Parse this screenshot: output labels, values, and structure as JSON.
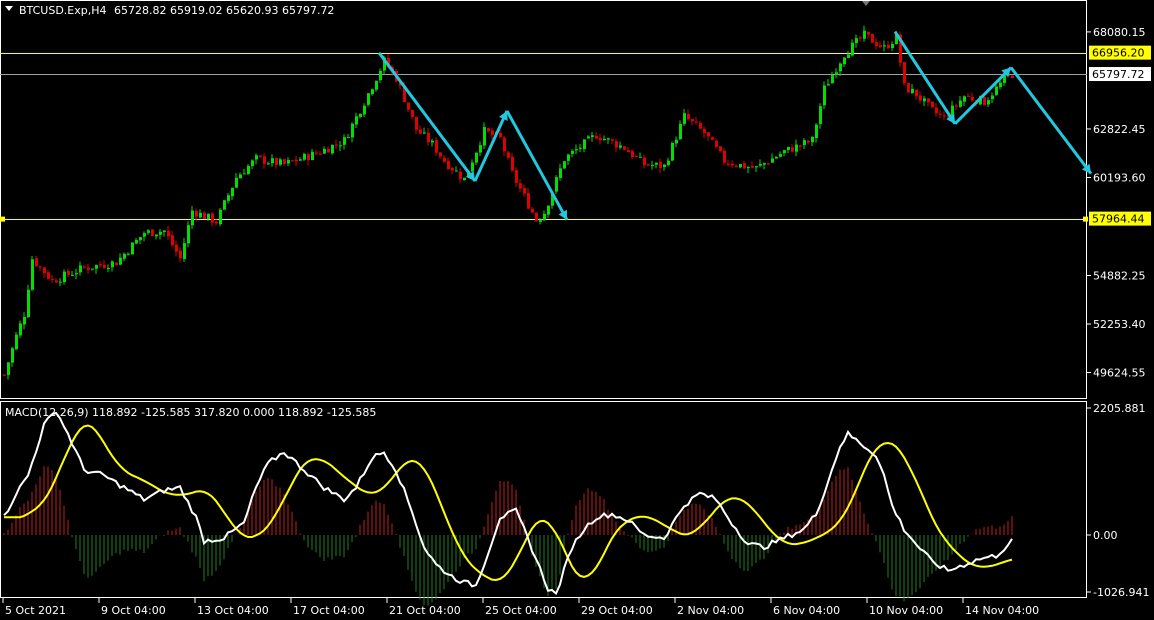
{
  "header": {
    "symbol": "BTCUSD.Exp,H4",
    "ohlc": "65728.82 65919.02 65620.93 65797.72"
  },
  "macd_header": "MACD(12,26,9) 118.892 -125.585 317.820 0.000 118.892 -125.585",
  "colors": {
    "background": "#000000",
    "bull_candle": "#00e000",
    "bear_candle": "#e00000",
    "hline": "#ffff00",
    "arrow": "#22c7e0",
    "macd_line": "#ffffff",
    "signal_line": "#ffff00",
    "hist_pos": "#c02020",
    "hist_neg": "#208020",
    "axis": "#ffffff"
  },
  "chart_data": [
    {
      "type": "candlestick",
      "title": "BTCUSD.Exp,H4",
      "price_ticks": [
        "68080.15",
        "62822.45",
        "60193.60",
        "54882.25",
        "52253.40",
        "49624.55"
      ],
      "ylim": [
        48300,
        69700
      ],
      "grid": false,
      "hlines": [
        {
          "value": 66956.2,
          "label": "66956.20",
          "kind": "level"
        },
        {
          "value": 57964.44,
          "label": "57964.44",
          "kind": "level"
        },
        {
          "value": 65797.72,
          "label": "65797.72",
          "kind": "current-price"
        }
      ],
      "anchors_close": [
        [
          0,
          49500
        ],
        [
          3,
          51600
        ],
        [
          5,
          52800
        ],
        [
          7,
          55800
        ],
        [
          12,
          54600
        ],
        [
          20,
          55300
        ],
        [
          28,
          55600
        ],
        [
          35,
          57200
        ],
        [
          40,
          57300
        ],
        [
          44,
          55800
        ],
        [
          47,
          58400
        ],
        [
          53,
          57800
        ],
        [
          58,
          60200
        ],
        [
          63,
          61200
        ],
        [
          70,
          60900
        ],
        [
          78,
          61500
        ],
        [
          85,
          62200
        ],
        [
          90,
          64300
        ],
        [
          95,
          66500
        ],
        [
          98,
          65600
        ],
        [
          103,
          62800
        ],
        [
          107,
          62000
        ],
        [
          110,
          61100
        ],
        [
          115,
          60100
        ],
        [
          120,
          62700
        ],
        [
          124,
          62300
        ],
        [
          127,
          60400
        ],
        [
          133,
          57900
        ],
        [
          135,
          58300
        ],
        [
          140,
          61200
        ],
        [
          148,
          62500
        ],
        [
          155,
          61800
        ],
        [
          160,
          60900
        ],
        [
          165,
          60800
        ],
        [
          170,
          63500
        ],
        [
          175,
          62600
        ],
        [
          180,
          61100
        ],
        [
          185,
          60800
        ],
        [
          188,
          60700
        ],
        [
          195,
          61600
        ],
        [
          202,
          62200
        ],
        [
          205,
          65000
        ],
        [
          210,
          66900
        ],
        [
          215,
          67900
        ],
        [
          220,
          67200
        ],
        [
          223,
          67800
        ],
        [
          225,
          65100
        ],
        [
          228,
          64700
        ],
        [
          232,
          63800
        ],
        [
          235,
          63400
        ],
        [
          240,
          64600
        ],
        [
          245,
          64300
        ],
        [
          250,
          65500
        ],
        [
          252,
          65797.72
        ]
      ],
      "arrows": [
        [
          [
            94,
            66950
          ],
          [
            118,
            60000
          ]
        ],
        [
          [
            118,
            60000
          ],
          [
            126,
            63800
          ]
        ],
        [
          [
            126,
            63800
          ],
          [
            141,
            57900
          ]
        ],
        [
          [
            223,
            68100
          ],
          [
            238,
            63100
          ]
        ],
        [
          [
            238,
            63100
          ],
          [
            252,
            66150
          ]
        ],
        [
          [
            252,
            66150
          ],
          [
            272,
            60400
          ]
        ]
      ]
    },
    {
      "type": "macd",
      "title": "MACD(12,26,9)",
      "ylim": [
        -1026.941,
        2205.881
      ],
      "tick_labels": [
        "2205.881",
        "0.00",
        "-1026.941"
      ],
      "anchors_macd": [
        [
          0,
          300
        ],
        [
          3,
          700
        ],
        [
          6,
          1000
        ],
        [
          10,
          1850
        ],
        [
          13,
          2100
        ],
        [
          16,
          1700
        ],
        [
          20,
          1100
        ],
        [
          25,
          1000
        ],
        [
          30,
          800
        ],
        [
          35,
          600
        ],
        [
          40,
          750
        ],
        [
          44,
          800
        ],
        [
          48,
          300
        ],
        [
          50,
          -100
        ],
        [
          55,
          -50
        ],
        [
          60,
          200
        ],
        [
          63,
          800
        ],
        [
          66,
          1200
        ],
        [
          70,
          1400
        ],
        [
          75,
          1100
        ],
        [
          80,
          800
        ],
        [
          85,
          600
        ],
        [
          88,
          800
        ],
        [
          92,
          1300
        ],
        [
          95,
          1400
        ],
        [
          98,
          1100
        ],
        [
          102,
          400
        ],
        [
          105,
          -200
        ],
        [
          108,
          -500
        ],
        [
          112,
          -700
        ],
        [
          115,
          -800
        ],
        [
          118,
          -850
        ],
        [
          121,
          -300
        ],
        [
          124,
          300
        ],
        [
          128,
          400
        ],
        [
          130,
          100
        ],
        [
          133,
          -400
        ],
        [
          136,
          -900
        ],
        [
          138,
          -1000
        ],
        [
          140,
          -600
        ],
        [
          142,
          -200
        ],
        [
          145,
          100
        ],
        [
          148,
          300
        ],
        [
          152,
          350
        ],
        [
          156,
          250
        ],
        [
          160,
          0
        ],
        [
          165,
          -50
        ],
        [
          170,
          500
        ],
        [
          174,
          700
        ],
        [
          178,
          600
        ],
        [
          182,
          200
        ],
        [
          186,
          -150
        ],
        [
          190,
          -200
        ],
        [
          195,
          -50
        ],
        [
          200,
          100
        ],
        [
          203,
          350
        ],
        [
          206,
          900
        ],
        [
          209,
          1500
        ],
        [
          211,
          1700
        ],
        [
          213,
          1600
        ],
        [
          215,
          1500
        ],
        [
          218,
          1350
        ],
        [
          220,
          1000
        ],
        [
          222,
          500
        ],
        [
          225,
          100
        ],
        [
          228,
          -150
        ],
        [
          232,
          -450
        ],
        [
          236,
          -600
        ],
        [
          240,
          -500
        ],
        [
          244,
          -400
        ],
        [
          248,
          -350
        ],
        [
          252,
          -100
        ]
      ],
      "signal_lag": 4
    }
  ],
  "time_labels": [
    {
      "label": "5 Oct 2021",
      "bar": 0
    },
    {
      "label": "9 Oct 04:00",
      "bar": 24
    },
    {
      "label": "13 Oct 04:00",
      "bar": 48
    },
    {
      "label": "17 Oct 04:00",
      "bar": 72
    },
    {
      "label": "21 Oct 04:00",
      "bar": 96
    },
    {
      "label": "25 Oct 04:00",
      "bar": 120
    },
    {
      "label": "29 Oct 04:00",
      "bar": 144
    },
    {
      "label": "2 Nov 04:00",
      "bar": 168
    },
    {
      "label": "6 Nov 04:00",
      "bar": 192
    },
    {
      "label": "10 Nov 04:00",
      "bar": 216
    },
    {
      "label": "14 Nov 04:00",
      "bar": 240
    }
  ]
}
